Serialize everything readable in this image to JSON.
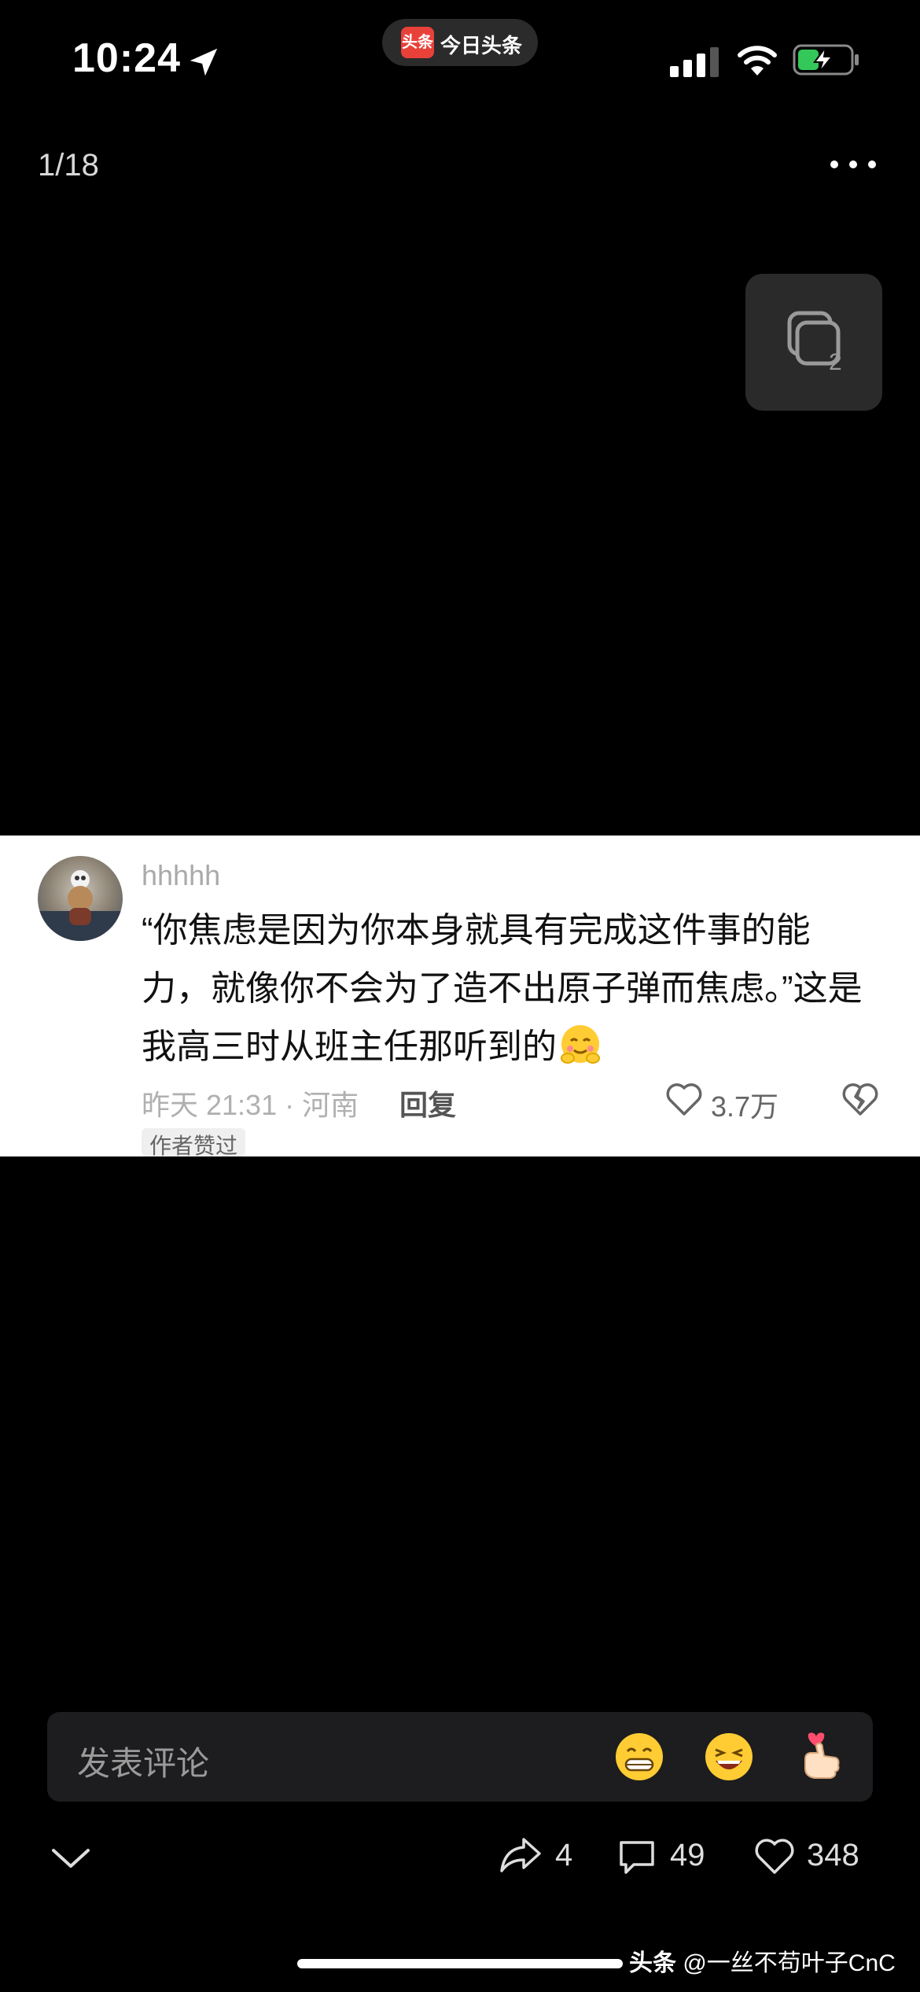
{
  "status_bar": {
    "time": "10:24",
    "app_badge": "头条",
    "app_name": "今日头条"
  },
  "viewer": {
    "counter": "1/18",
    "multi_count": "2"
  },
  "comment": {
    "username": "hhhhh",
    "text": "“你焦虑是因为你本身就具有完成这件事的能力，就像你不会为了造不出原子弹而焦虑。”这是我高三时从班主任那听到的",
    "emoji_icon": "shy-smile-emoji",
    "time_location": "昨天 21:31 · 河南",
    "reply_label": "回复",
    "like_count": "3.7万",
    "author_tag": "作者赞过"
  },
  "bottom": {
    "placeholder": "发表评论",
    "emojis": [
      "grin-emoji",
      "laugh-emoji",
      "finger-heart-emoji"
    ],
    "share_count": "4",
    "comment_count": "49",
    "like_count": "348"
  },
  "watermark": {
    "brand": "头条",
    "handle": "@一丝不苟叶子CnC"
  },
  "colors": {
    "background": "#000000",
    "card": "#ffffff",
    "app_red": "#e8413a",
    "battery_green": "#34c759"
  }
}
